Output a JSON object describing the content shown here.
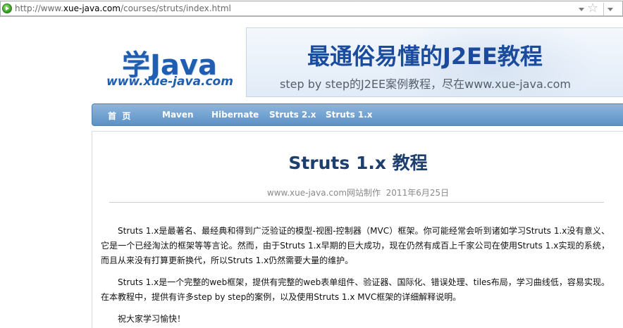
{
  "browser": {
    "url_prefix": "http://www.",
    "url_host": "xue-java.com",
    "url_path": "/courses/struts/index.html"
  },
  "logo": {
    "title": "学Java",
    "subtitle": "www.xue-java.com"
  },
  "banner": {
    "title": "最通俗易懂的J2EE教程",
    "subtitle": "step by step的J2EE案例教程，尽在www.xue-java.com"
  },
  "nav": {
    "items": [
      {
        "label": "首  页"
      },
      {
        "label": "Maven"
      },
      {
        "label": "Hibernate"
      },
      {
        "label": "Struts 2.x"
      },
      {
        "label": "Struts 1.x"
      }
    ]
  },
  "article": {
    "title": "Struts 1.x 教程",
    "meta": "www.xue-java.com网站制作  2011年6月25日",
    "paragraphs": [
      "Struts 1.x是最著名、最经典和得到广泛验证的模型-视图-控制器（MVC）框架。你可能经常会听到诸如学习Struts 1.x没有意义、它是一个已经淘汰的框架等等言论。然而，由于Struts 1.x早期的巨大成功，现在仍然有成百上千家公司在使用Struts 1.x实现的系统，而且从来没有打算更新换代，所以Struts 1.x仍然需要大量的维护。",
      "Struts 1.x是一个完整的web框架，提供有完整的web表单组件、验证器、国际化、错误处理、tiles布局，学习曲线低，容易实现。在本教程中，提供有许多step by step的案例，以及使用Struts 1.x MVC框架的详细解释说明。",
      "祝大家学习愉快！"
    ]
  }
}
